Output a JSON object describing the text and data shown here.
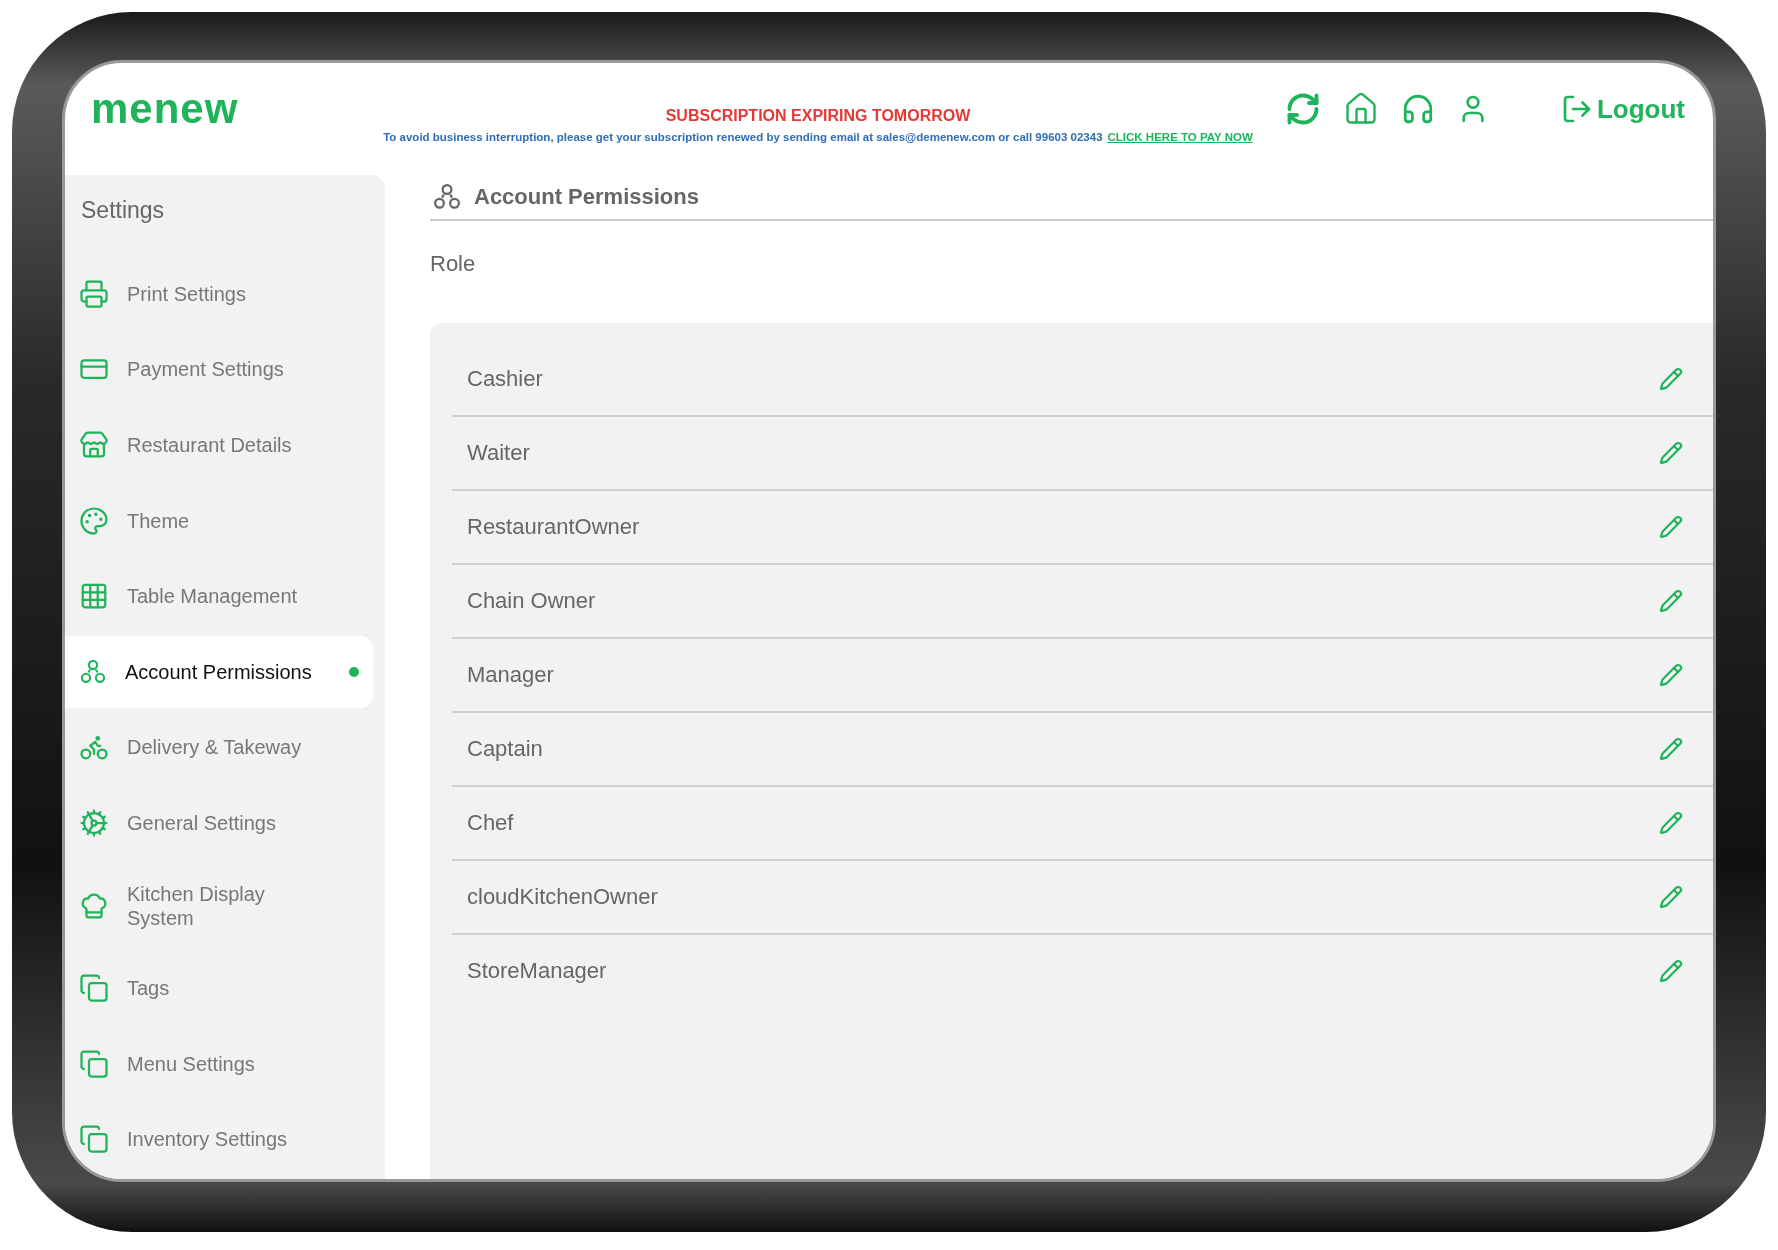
{
  "header": {
    "logo": "menew",
    "alert_title": "SUBSCRIPTION EXPIRING TOMORROW",
    "alert_message": "To avoid business interruption, please get your subscription renewed by sending email at sales@demenew.com or call 99603 02343",
    "pay_link": "CLICK HERE TO PAY NOW",
    "logout": "Logout"
  },
  "sidebar": {
    "title": "Settings",
    "items": [
      {
        "label": "Print Settings",
        "selected": false
      },
      {
        "label": "Payment Settings",
        "selected": false
      },
      {
        "label": "Restaurant Details",
        "selected": false
      },
      {
        "label": "Theme",
        "selected": false
      },
      {
        "label": "Table Management",
        "selected": false
      },
      {
        "label": "Account Permissions",
        "selected": true
      },
      {
        "label": "Delivery & Takeway",
        "selected": false
      },
      {
        "label": "General Settings",
        "selected": false
      },
      {
        "label": "Kitchen Display System",
        "selected": false
      },
      {
        "label": "Tags",
        "selected": false
      },
      {
        "label": "Menu Settings",
        "selected": false
      },
      {
        "label": "Inventory Settings",
        "selected": false
      }
    ]
  },
  "page": {
    "title": "Account Permissions",
    "section_label": "Role",
    "roles": [
      "Cashier",
      "Waiter",
      "RestaurantOwner",
      "Chain Owner",
      "Manager",
      "Captain",
      "Chef",
      "cloudKitchenOwner",
      "StoreManager"
    ]
  }
}
